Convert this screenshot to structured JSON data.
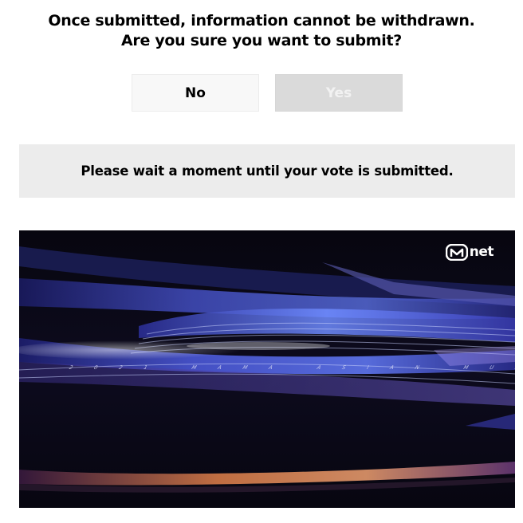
{
  "dialog": {
    "message_line1": "Once submitted, information cannot be withdrawn.",
    "message_line2": "Are you sure you want to submit?",
    "no_label": "No",
    "yes_label": "Yes"
  },
  "banner": {
    "text": "Please wait a moment until your vote is submitted."
  },
  "video": {
    "logo_text": "net",
    "logo_icon": "mnet-m-logo-icon",
    "caption": "2021 MAMA ASIAN MUSIC AWARDS"
  },
  "colors": {
    "no_button_bg": "#f8f8f8",
    "yes_button_bg": "#dadada",
    "banner_bg": "#ececec",
    "video_bg": "#0a0916",
    "accent_blue": "#3f57d8",
    "accent_orange": "#e0804a"
  }
}
